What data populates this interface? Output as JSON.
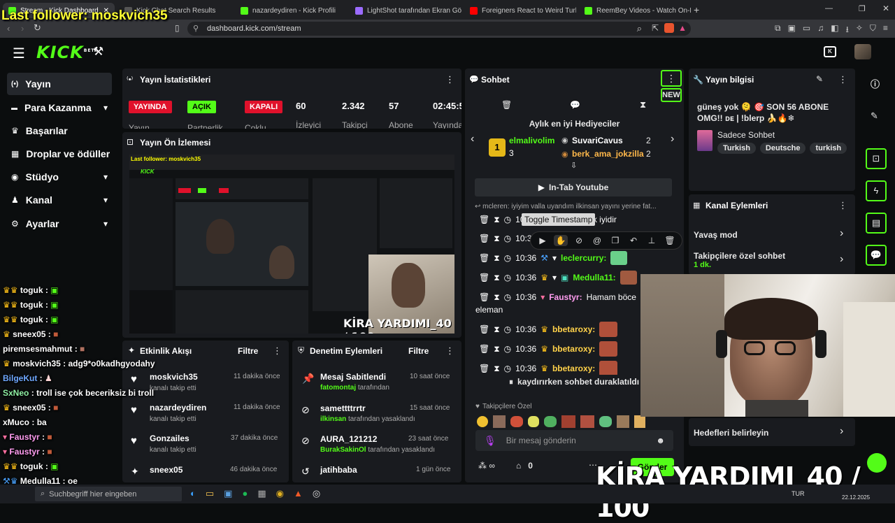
{
  "overlay": {
    "last_follower": "Last follower: moskvich35",
    "goal_text": "KİRA YARDIMI_40 / 100"
  },
  "browser": {
    "tabs": [
      {
        "label": "Stream - Kick Dashboard",
        "color": "#53fc18"
      },
      {
        "label": "Kick Chat Search Results",
        "color": "#555"
      },
      {
        "label": "nazardeydiren - Kick Profili",
        "color": "#53fc18"
      },
      {
        "label": "LightShot tarafından Ekran Görüntüs",
        "color": "#9b6bff"
      },
      {
        "label": "Foreigners React to Weird Turkish Sn",
        "color": "#ff0000"
      },
      {
        "label": "ReemBey Videos - Watch On-Deman",
        "color": "#53fc18"
      }
    ],
    "url": "dashboard.kick.com/stream"
  },
  "header": {
    "logo": "KICK",
    "logo_sup": "BETA"
  },
  "sidebar": {
    "items": [
      {
        "label": "Yayın",
        "icon": "broadcast-icon",
        "glyph": "(•)"
      },
      {
        "label": "Para Kazanma",
        "icon": "money-icon",
        "glyph": "▬"
      },
      {
        "label": "Başarılar",
        "icon": "trophy-icon",
        "glyph": "♛"
      },
      {
        "label": "Droplar ve ödüller",
        "icon": "gift-icon",
        "glyph": "▦"
      },
      {
        "label": "Stüdyo",
        "icon": "studio-icon",
        "glyph": "◉"
      },
      {
        "label": "Kanal",
        "icon": "user-icon",
        "glyph": "♟"
      },
      {
        "label": "Ayarlar",
        "icon": "gear-icon",
        "glyph": "⚙"
      }
    ]
  },
  "stats": {
    "title": "Yayın İstatistikleri",
    "badges": {
      "live": "YAYINDA",
      "open": "AÇIK",
      "closed": "KAPALI"
    },
    "badge_labels": [
      "Yayın",
      "Partnerlik",
      "Çoklu"
    ],
    "values": [
      {
        "value": "60",
        "label": "İzleyici"
      },
      {
        "value": "2.342",
        "label": "Takipçi"
      },
      {
        "value": "57",
        "label": "Abone"
      },
      {
        "value": "02:45:5",
        "label": "Yayında"
      }
    ]
  },
  "preview": {
    "title": "Yayın Ön İzlemesi"
  },
  "activity": {
    "title": "Etkinlik Akışı",
    "filter": "Filtre",
    "items": [
      {
        "name": "moskvich35",
        "sub": "kanalı takip etti",
        "time": "11 dakika önce"
      },
      {
        "name": "nazardeydiren",
        "sub": "kanalı takip etti",
        "time": "11 dakika önce"
      },
      {
        "name": "Gonzailes",
        "sub": "kanalı takip etti",
        "time": "37 dakika önce"
      },
      {
        "name": "sneex05",
        "sub": "",
        "time": "46 dakika önce"
      }
    ]
  },
  "moderation": {
    "title": "Denetim Eylemleri",
    "filter": "Filtre",
    "items": [
      {
        "name": "Mesaj Sabitlendi",
        "user": "fatomontaj",
        "suffix": "tarafından",
        "time": "10 saat önce"
      },
      {
        "name": "samettttrrtr",
        "user": "ilkinsan",
        "suffix": "tarafından yasaklandı",
        "time": "15 saat önce"
      },
      {
        "name": "AURA_121212",
        "user": "BurakSakinOl",
        "suffix": "tarafından yasaklandı",
        "time": "23 saat önce"
      },
      {
        "name": "jatihbaba",
        "user": "",
        "suffix": "",
        "time": "1 gün önce"
      }
    ]
  },
  "chat": {
    "title": "Sohbet",
    "new_label": "NEW",
    "gifters_title": "Aylık en iyi Hediyeciler",
    "gifters": [
      {
        "rank": "1",
        "name": "elmalivolim",
        "count": "3"
      },
      {
        "rank": "",
        "name": "SuvariCavus",
        "count": "2"
      },
      {
        "rank": "",
        "name": "berk_ama_jokzilla",
        "count": "2"
      }
    ],
    "youtube_btn": "In-Tab Youtube",
    "reply_preview": "mcleren: iyiyim valla uyandım ilkinsan yayını yerine fat...",
    "tooltip": "Toggle Timestamp",
    "messages": [
      {
        "time": "10:3",
        "user": "",
        "text": "klik iyidir",
        "color": "#fff"
      },
      {
        "time": "10:3",
        "user": "",
        "text": "",
        "color": "#fff"
      },
      {
        "time": "10:36",
        "user": "leclercurry:",
        "text": "",
        "color": "#53fc18"
      },
      {
        "time": "10:36",
        "user": "Medulla11:",
        "text": "",
        "color": "#53fc18"
      },
      {
        "time": "10:36",
        "user": "Faustyr:",
        "text": "Hamam böce",
        "color": "#ff9df0"
      },
      {
        "time": "10:36",
        "user": "bbetaroxy:",
        "text": "",
        "color": "#ffd24a"
      },
      {
        "time": "10:36",
        "user": "bbetaroxy:",
        "text": "",
        "color": "#ffd24a"
      },
      {
        "time": "10:36",
        "user": "bbetaroxy:",
        "text": "",
        "color": "#ffd24a"
      }
    ],
    "wrap_text": "eleman",
    "paused": "kaydırırken sohbet duraklatıldı",
    "followers_only": "Takipçilere Özel",
    "input_placeholder": "Bir mesaj gönderin",
    "points": "0",
    "send": "Gönder"
  },
  "stream_info": {
    "title": "Yayın bilgisi",
    "stream_title": "güneş yok 🫠 🎯 SON 56 ABONE OMG!! ᴅᴇ | !blerp 🍌🔥❄",
    "category": "Sadece Sohbet",
    "tags": [
      "Turkish",
      "Deutsche",
      "turkish"
    ]
  },
  "channel_actions": {
    "title": "Kanal Eylemleri",
    "items": [
      {
        "label": "Yavaş mod",
        "sub": ""
      },
      {
        "label": "Takipçilere özel sohbet",
        "sub": "1 dk."
      }
    ],
    "goals": "Hedefleri belirleyin"
  },
  "overlay_chat": [
    {
      "user": "toguk",
      "text": "",
      "color": "#fff"
    },
    {
      "user": "toguk",
      "text": "",
      "color": "#fff"
    },
    {
      "user": "toguk",
      "text": "",
      "color": "#fff"
    },
    {
      "user": "sneex05",
      "text": "",
      "color": "#fff"
    },
    {
      "user": "piremsesmahmut",
      "text": "",
      "color": "#fff"
    },
    {
      "user": "moskvich35",
      "text": "adg9*o0kadhgyodahy",
      "color": "#fff"
    },
    {
      "user": "BilgeKut",
      "text": "",
      "color": "#6fa8ff"
    },
    {
      "user": "SxNeo",
      "text": "troll ise çok beceriksiz bi troll",
      "color": "#8ff0a4"
    },
    {
      "user": "sneex05",
      "text": "",
      "color": "#fff"
    },
    {
      "user": "xMuco",
      "text": "ba",
      "color": "#fff"
    },
    {
      "user": "Faustyr",
      "text": "",
      "color": "#ff9df0"
    },
    {
      "user": "Faustyr",
      "text": "",
      "color": "#ff9df0"
    },
    {
      "user": "toguk",
      "text": "",
      "color": "#fff"
    },
    {
      "user": "Medulla11",
      "text": "oe",
      "color": "#fff"
    }
  ],
  "taskbar": {
    "search_placeholder": "Suchbegriff hier eingeben",
    "lang": "TUR",
    "date": "22.12.2025"
  },
  "colors": {
    "accent": "#53fc18",
    "live_red": "#e0112b",
    "panel": "#191b1f"
  }
}
